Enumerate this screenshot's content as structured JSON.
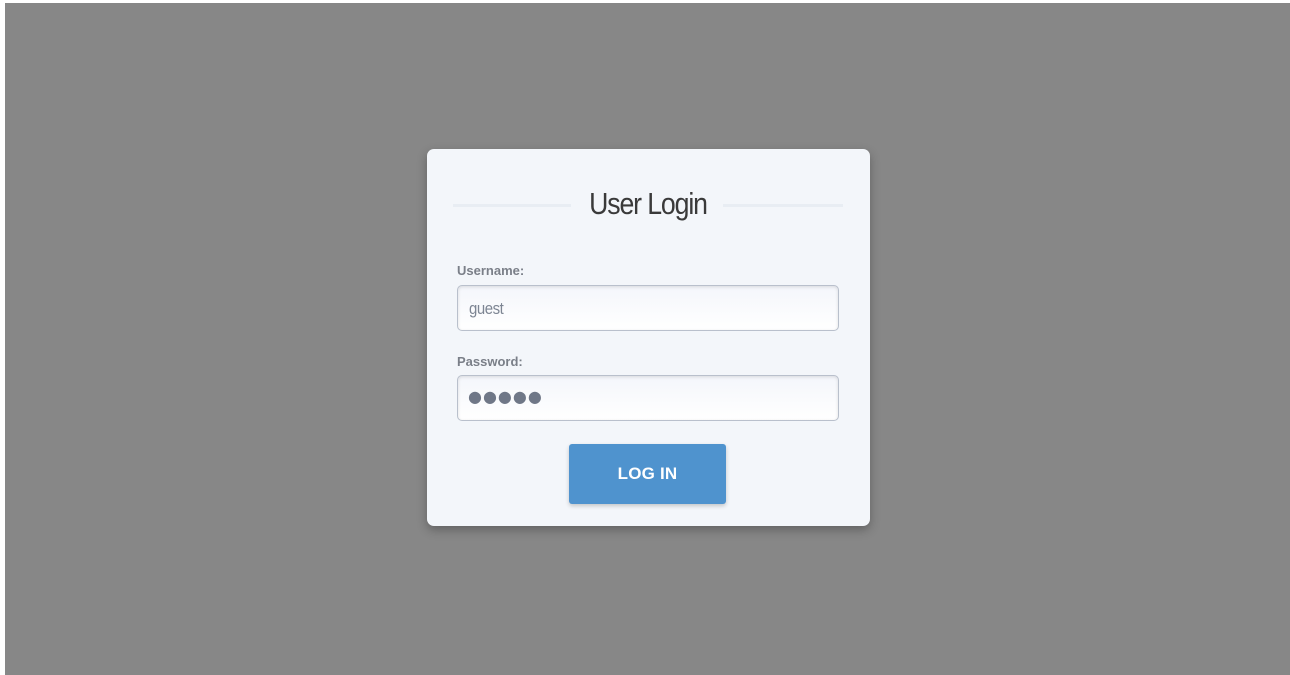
{
  "login": {
    "title": "User Login",
    "username_label": "Username:",
    "username_value": "guest",
    "password_label": "Password:",
    "password_mask": "●●●●●",
    "login_button": "LOG IN"
  },
  "colors": {
    "backdrop": "#878787",
    "card": "#f3f6fa",
    "button": "#4f93ce"
  }
}
